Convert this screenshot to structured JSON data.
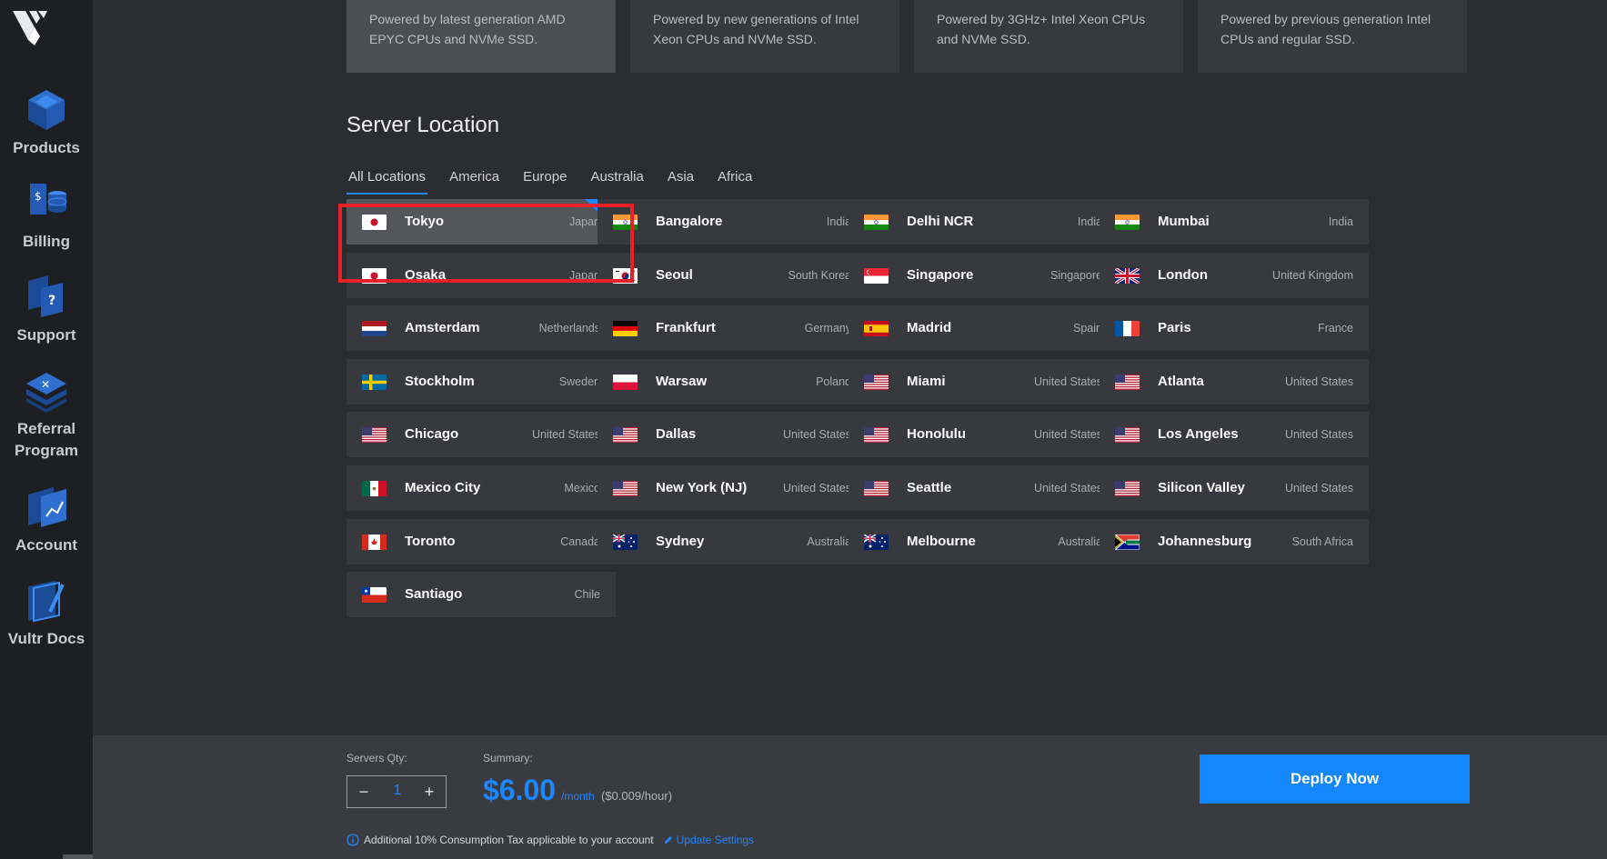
{
  "sidebar": {
    "items": [
      {
        "label": "Products",
        "icon": "products-icon"
      },
      {
        "label": "Billing",
        "icon": "billing-icon"
      },
      {
        "label": "Support",
        "icon": "support-icon"
      },
      {
        "label": "Referral Program",
        "icon": "referral-icon"
      },
      {
        "label": "Account",
        "icon": "account-icon"
      },
      {
        "label": "Vultr Docs",
        "icon": "docs-icon"
      }
    ]
  },
  "server_types": [
    {
      "description": "Powered by latest generation AMD EPYC CPUs and NVMe SSD."
    },
    {
      "description": "Powered by new generations of Intel Xeon CPUs and NVMe SSD."
    },
    {
      "description": "Powered by 3GHz+ Intel Xeon CPUs and NVMe SSD."
    },
    {
      "description": "Powered by previous generation Intel CPUs and regular SSD."
    }
  ],
  "location_section": {
    "title": "Server Location",
    "tabs": [
      "All Locations",
      "America",
      "Europe",
      "Australia",
      "Asia",
      "Africa"
    ],
    "active_tab": "All Locations",
    "selected": "Tokyo",
    "locations": [
      {
        "city": "Tokyo",
        "country": "Japan",
        "flag": "jp"
      },
      {
        "city": "Bangalore",
        "country": "India",
        "flag": "in"
      },
      {
        "city": "Delhi NCR",
        "country": "India",
        "flag": "in"
      },
      {
        "city": "Mumbai",
        "country": "India",
        "flag": "in"
      },
      {
        "city": "Osaka",
        "country": "Japan",
        "flag": "jp"
      },
      {
        "city": "Seoul",
        "country": "South Korea",
        "flag": "kr"
      },
      {
        "city": "Singapore",
        "country": "Singapore",
        "flag": "sg"
      },
      {
        "city": "London",
        "country": "United Kingdom",
        "flag": "gb"
      },
      {
        "city": "Amsterdam",
        "country": "Netherlands",
        "flag": "nl"
      },
      {
        "city": "Frankfurt",
        "country": "Germany",
        "flag": "de"
      },
      {
        "city": "Madrid",
        "country": "Spain",
        "flag": "es"
      },
      {
        "city": "Paris",
        "country": "France",
        "flag": "fr"
      },
      {
        "city": "Stockholm",
        "country": "Sweden",
        "flag": "se"
      },
      {
        "city": "Warsaw",
        "country": "Poland",
        "flag": "pl"
      },
      {
        "city": "Miami",
        "country": "United States",
        "flag": "us"
      },
      {
        "city": "Atlanta",
        "country": "United States",
        "flag": "us"
      },
      {
        "city": "Chicago",
        "country": "United States",
        "flag": "us"
      },
      {
        "city": "Dallas",
        "country": "United States",
        "flag": "us"
      },
      {
        "city": "Honolulu",
        "country": "United States",
        "flag": "us"
      },
      {
        "city": "Los Angeles",
        "country": "United States",
        "flag": "us"
      },
      {
        "city": "Mexico City",
        "country": "Mexico",
        "flag": "mx"
      },
      {
        "city": "New York (NJ)",
        "country": "United States",
        "flag": "us"
      },
      {
        "city": "Seattle",
        "country": "United States",
        "flag": "us"
      },
      {
        "city": "Silicon Valley",
        "country": "United States",
        "flag": "us"
      },
      {
        "city": "Toronto",
        "country": "Canada",
        "flag": "ca"
      },
      {
        "city": "Sydney",
        "country": "Australia",
        "flag": "au"
      },
      {
        "city": "Melbourne",
        "country": "Australia",
        "flag": "au"
      },
      {
        "city": "Johannesburg",
        "country": "South Africa",
        "flag": "za"
      },
      {
        "city": "Santiago",
        "country": "Chile",
        "flag": "cl"
      }
    ]
  },
  "footer": {
    "qty_label": "Servers Qty:",
    "qty_value": "1",
    "minus": "−",
    "plus": "+",
    "summary_label": "Summary:",
    "price": "$6.00",
    "per_month": "/month",
    "per_hour": "($0.009/hour)",
    "tax_note": "Additional 10% Consumption Tax applicable to your account",
    "update_link": "Update Settings",
    "deploy_label": "Deploy Now"
  },
  "colors": {
    "accent": "#1e86ff",
    "highlight": "#e8202a",
    "background": "#2c2d31",
    "card": "#38393e",
    "sidebar": "#1e1f23"
  }
}
